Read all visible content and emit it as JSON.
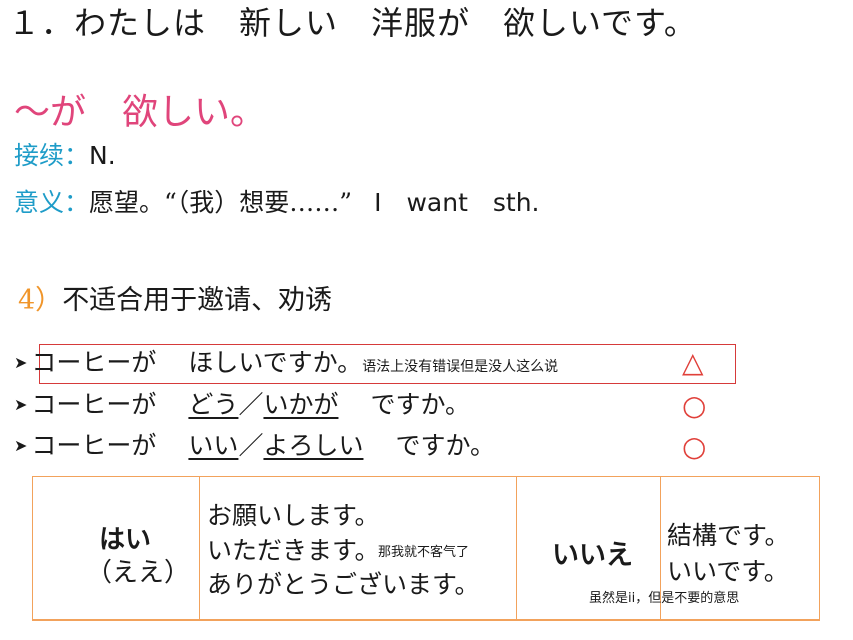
{
  "title": "１．わたしは　新しい　洋服が　欲しいです。",
  "pattern": "～が　欲しい。",
  "connection": {
    "label": "接续：",
    "value": "N."
  },
  "meaning": {
    "label": "意义：",
    "value": "愿望。“（我）想要……”",
    "english": "I　want　sth."
  },
  "subpoint": {
    "number": "4）",
    "text": "不适合用于邀请、劝诱"
  },
  "examples": [
    {
      "bullet": "➤",
      "before": "コーヒーが",
      "phrase": "ほしいですか。",
      "note": "语法上没有错误但是没人这么说",
      "mark": "△"
    },
    {
      "bullet": "➤",
      "before": "コーヒーが",
      "opt1": "どう",
      "sep": "／",
      "opt2": "いかが",
      "after": "ですか。",
      "mark": "○"
    },
    {
      "bullet": "➤",
      "before": "コーヒーが",
      "opt1": "いい",
      "sep": "／",
      "opt2": "よろしい",
      "after": "ですか。",
      "mark": "○"
    }
  ],
  "table": {
    "yes": "はい",
    "yes_alt": "（ええ）",
    "yes_replies": [
      "お願いします。",
      "いただきます。",
      "ありがとうございます。"
    ],
    "yes_note": "那我就不客气了",
    "no": "いいえ",
    "no_replies": [
      "結構です。",
      "いいです。"
    ],
    "no_note": "虽然是ii，但是不要的意思"
  },
  "colors": {
    "pink": "#e0457b",
    "cyan": "#1e9cc8",
    "orange": "#f0952a",
    "red": "#e0403a",
    "table_border": "#f2a25c"
  }
}
